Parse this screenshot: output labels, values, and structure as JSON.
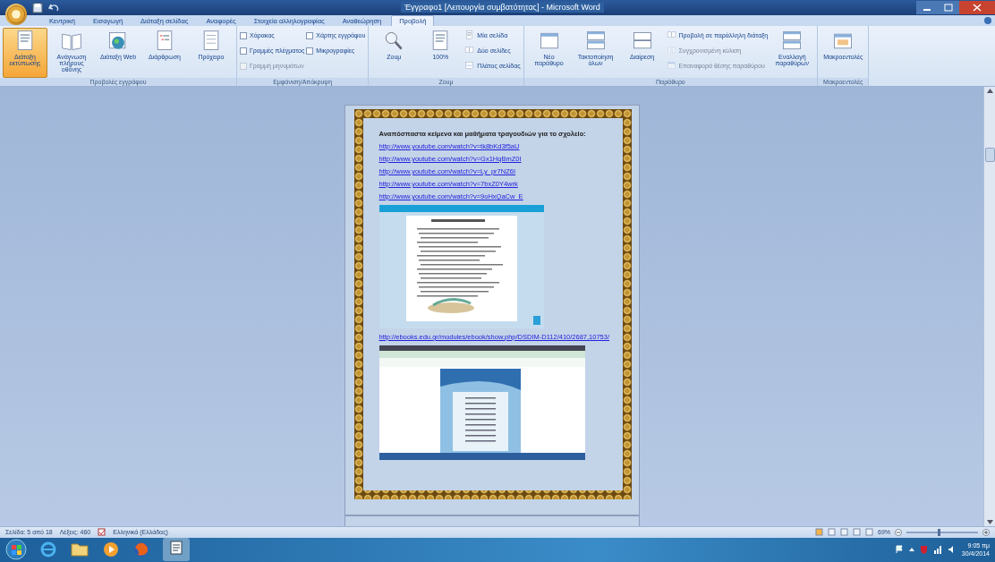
{
  "window": {
    "title": "Έγγραφο1 [Λειτουργία συμβατότητας] - Microsoft Word"
  },
  "tabs": [
    {
      "label": "Κεντρική",
      "selected": false
    },
    {
      "label": "Εισαγωγή",
      "selected": false
    },
    {
      "label": "Διάταξη σελίδας",
      "selected": false
    },
    {
      "label": "Αναφορές",
      "selected": false
    },
    {
      "label": "Στοιχεία αλληλογραφίας",
      "selected": false
    },
    {
      "label": "Αναθεώρηση",
      "selected": false
    },
    {
      "label": "Προβολή",
      "selected": true
    }
  ],
  "ribbon": [
    {
      "label": "Προβολές εγγράφου",
      "items": [
        {
          "kind": "large",
          "label": "Διάταξη εκτύπωσης",
          "selected": true
        },
        {
          "kind": "large",
          "label": "Ανάγνωση πλήρους οθόνης",
          "selected": false
        },
        {
          "kind": "large",
          "label": "Διάταξη Web",
          "selected": false
        },
        {
          "kind": "large",
          "label": "Διάρθρωση",
          "selected": false
        },
        {
          "kind": "large",
          "label": "Πρόχειρο",
          "selected": false
        }
      ]
    },
    {
      "label": "Εμφάνιση/Απόκρυψη",
      "items": [
        {
          "kind": "check",
          "label": "Χάρακας",
          "checked": false,
          "disabled": false
        },
        {
          "kind": "check",
          "label": "Γραμμές πλέγματος",
          "checked": false,
          "disabled": false
        },
        {
          "kind": "check",
          "label": "Γραμμή μηνυμάτων",
          "checked": false,
          "disabled": true
        },
        {
          "kind": "check",
          "label": "Χάρτης εγγράφου",
          "checked": false,
          "disabled": false
        },
        {
          "kind": "check",
          "label": "Μικρογραφίες",
          "checked": false,
          "disabled": false
        }
      ]
    },
    {
      "label": "Ζουμ",
      "items": [
        {
          "kind": "large",
          "label": "Ζουμ",
          "selected": false
        },
        {
          "kind": "large",
          "label": "100%",
          "selected": false
        },
        {
          "kind": "small",
          "label": "Μία σελίδα",
          "disabled": false
        },
        {
          "kind": "small",
          "label": "Δύο σελίδες",
          "disabled": false
        },
        {
          "kind": "small",
          "label": "Πλάτος σελίδας",
          "disabled": false
        }
      ]
    },
    {
      "label": "Παράθυρο",
      "items": [
        {
          "kind": "large",
          "label": "Νέο παράθυρο",
          "selected": false
        },
        {
          "kind": "large",
          "label": "Τακτοποίηση όλων",
          "selected": false
        },
        {
          "kind": "large",
          "label": "Διαίρεση",
          "selected": false
        },
        {
          "kind": "small",
          "label": "Προβολή σε παράλληλη διάταξη",
          "disabled": false
        },
        {
          "kind": "small",
          "label": "Συγχρονισμένη κύλιση",
          "disabled": true
        },
        {
          "kind": "small",
          "label": "Επαναφορά θέσης παραθύρου",
          "disabled": true
        },
        {
          "kind": "large",
          "label": "Εναλλαγή παραθύρων",
          "selected": false
        }
      ]
    },
    {
      "label": "Μακροεντολές",
      "items": [
        {
          "kind": "large",
          "label": "Μακροεντολές",
          "selected": false
        }
      ]
    }
  ],
  "document": {
    "blocks": [
      {
        "kind": "heading",
        "text": "Αναπόσπαστα κείμενα και μαθήματα τραγουδιών για το σχολείο:"
      },
      {
        "kind": "link",
        "text": "http://www.youtube.com/watch?v=tk8bKd3f5aU"
      },
      {
        "kind": "link",
        "text": "http://www.youtube.com/watch?v=Gx1HqBmZ0I"
      },
      {
        "kind": "link",
        "text": "http://www.youtube.com/watch?v=Ly_pr7NZ6I"
      },
      {
        "kind": "link",
        "text": "http://www.youtube.com/watch?v=7bxZ0Y4wrk"
      },
      {
        "kind": "link",
        "text": "http://www.youtube.com/watch?v=9oHxQaCw_E"
      },
      {
        "kind": "document-screenshot"
      },
      {
        "kind": "link",
        "text": "http://ebooks.edu.gr/modules/ebook/show.php/DSDIM-D112/410/2687,10753/"
      },
      {
        "kind": "webpage-screenshot"
      }
    ]
  },
  "status_bar": {
    "page": "Σελίδα: 5 από 18",
    "words": "Λέξεις: 460",
    "language": "Ελληνικά (Ελλάδας)",
    "zoom": "69%",
    "zoom_level": {
      "level": 0.45
    }
  },
  "taskbar": {
    "time": "9:05 πμ",
    "date": "30/4/2014"
  }
}
